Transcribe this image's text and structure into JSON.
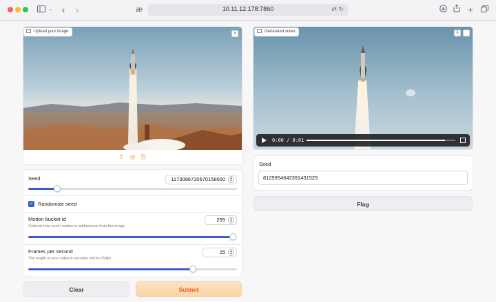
{
  "browser": {
    "url": "10.11.12.178:7860",
    "logo": "æ"
  },
  "input_image": {
    "label": "Upload your image",
    "close": "×"
  },
  "seed_control": {
    "label": "Seed",
    "value": "1173086720670158000",
    "slider_fraction": 0.14
  },
  "randomize": {
    "label": "Randomize seed",
    "checked": true
  },
  "motion_bucket": {
    "label": "Motion bucket id",
    "description": "Controls how much motion to add/remove from the image",
    "value": "255",
    "slider_fraction": 1.0
  },
  "fps": {
    "label": "Frames per second",
    "description": "The length of your video in seconds will be 25/fps",
    "value": "25",
    "slider_fraction": 0.79
  },
  "buttons": {
    "clear": "Clear",
    "submit": "Submit",
    "flag": "Flag"
  },
  "output_video": {
    "label": "Generated video",
    "time": "0:00 / 0:01",
    "progress_fraction": 0.93
  },
  "output_seed": {
    "label": "Seed",
    "value": "8129954642391431525"
  },
  "colors": {
    "accent": "#3b5cc9",
    "submit_text": "#ea580c"
  }
}
